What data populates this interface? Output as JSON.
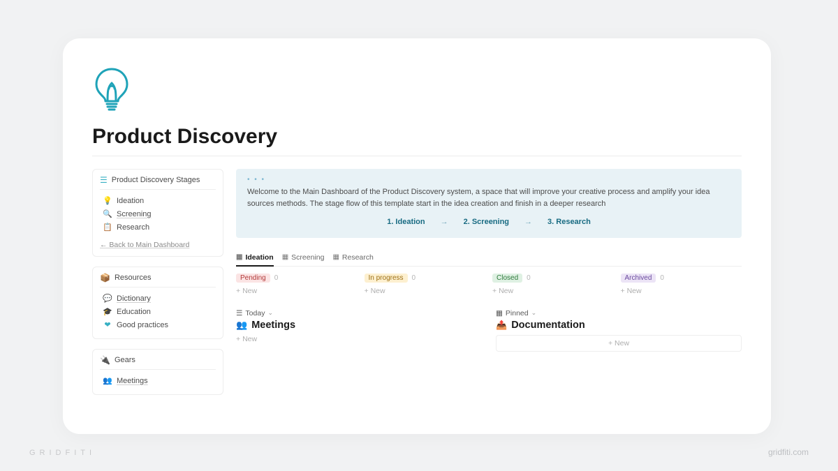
{
  "page": {
    "title": "Product Discovery"
  },
  "sidebar": {
    "stages": {
      "header": "Product Discovery Stages",
      "items": [
        {
          "label": "Ideation",
          "icon": "💡"
        },
        {
          "label": "Screening",
          "icon": "🔍",
          "underline": true
        },
        {
          "label": "Research",
          "icon": "📋"
        }
      ],
      "back_label": "← Back to Main Dashboard"
    },
    "resources": {
      "header": "Resources",
      "items": [
        {
          "label": "Dictionary",
          "icon": "💬"
        },
        {
          "label": "Education",
          "icon": "🎓"
        },
        {
          "label": "Good practices",
          "icon": "❤"
        }
      ]
    },
    "gears": {
      "header": "Gears",
      "items": [
        {
          "label": "Meetings",
          "icon": "👥"
        }
      ]
    }
  },
  "callout": {
    "description": "Welcome to the Main Dashboard of the Product Discovery system, a space that will improve your creative process and amplify your idea sources methods. The stage flow of this template start in the idea creation and finish in a deeper research",
    "stages": [
      "1. Ideation",
      "2. Screening",
      "3. Research"
    ]
  },
  "tabs": [
    {
      "label": "Ideation",
      "active": true
    },
    {
      "label": "Screening",
      "active": false
    },
    {
      "label": "Research",
      "active": false
    }
  ],
  "board": [
    {
      "label": "Pending",
      "count": "0",
      "color": "red"
    },
    {
      "label": "In progress",
      "count": "0",
      "color": "yellow"
    },
    {
      "label": "Closed",
      "count": "0",
      "color": "green"
    },
    {
      "label": "Archived",
      "count": "0",
      "color": "purple"
    }
  ],
  "new_label": "New",
  "sections": {
    "left": {
      "tag": "Today",
      "title": "Meetings"
    },
    "right": {
      "tag": "Pinned",
      "title": "Documentation"
    }
  },
  "footer": {
    "brand": "GRIDFITI",
    "url": "gridfiti.com"
  }
}
